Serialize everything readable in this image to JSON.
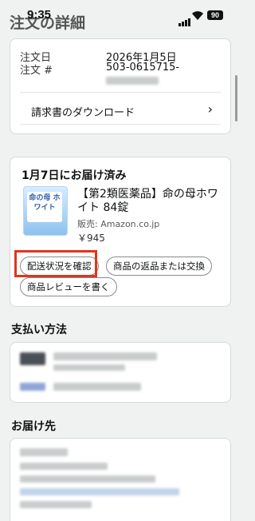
{
  "status": {
    "time": "9:35",
    "battery": "90"
  },
  "page": {
    "title": "注文の詳細"
  },
  "order": {
    "date_label": "注文日",
    "date_value": "2026年1月5日",
    "number_label": "注文 #",
    "number_value": "503-0615715-",
    "invoice_link": "請求書のダウンロード"
  },
  "delivery": {
    "status": "1月7日にお届け済み",
    "product_name": "【第2類医薬品】命の母ホワイト 84錠",
    "seller": "販売: Amazon.co.jp",
    "price": "￥945",
    "buttons": {
      "track": "配送状況を確認",
      "return": "商品の返品または交換",
      "review": "商品レビューを書く"
    },
    "product_image_text": "命の母 ホワイト"
  },
  "payment": {
    "heading": "支払い方法"
  },
  "shipping": {
    "heading": "お届け先"
  },
  "colors": {
    "highlight": "#e1351a",
    "background": "#f0f2f2"
  }
}
